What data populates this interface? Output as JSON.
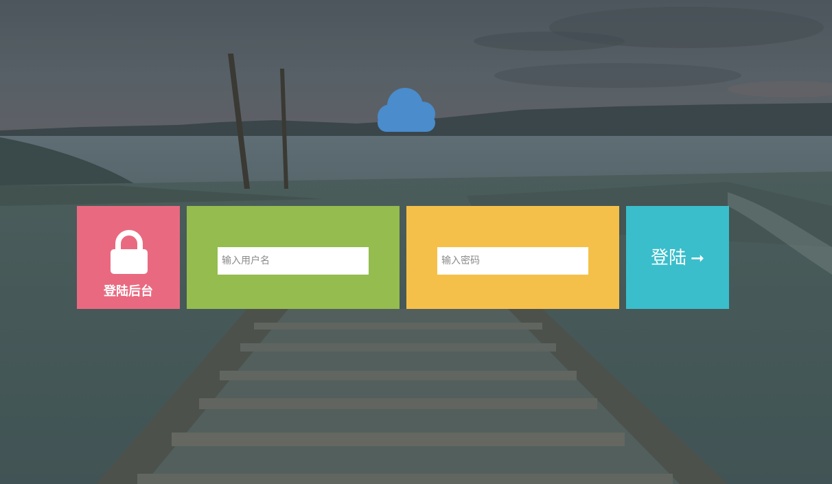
{
  "theme": {
    "lock_tile_color": "#e96a80",
    "user_tile_color": "#94bc4f",
    "pass_tile_color": "#f5c04a",
    "login_tile_color": "#3abecb",
    "cloud_color": "#4a8ccc"
  },
  "logo": {
    "icon": "cloud-icon"
  },
  "lock_tile": {
    "icon": "lock-icon",
    "caption": "登陆后台"
  },
  "username": {
    "placeholder": "输入用户名",
    "value": ""
  },
  "password": {
    "placeholder": "输入密码",
    "value": ""
  },
  "login_button": {
    "label": "登陆",
    "arrow": "➞",
    "icon": "arrow-right-icon"
  }
}
